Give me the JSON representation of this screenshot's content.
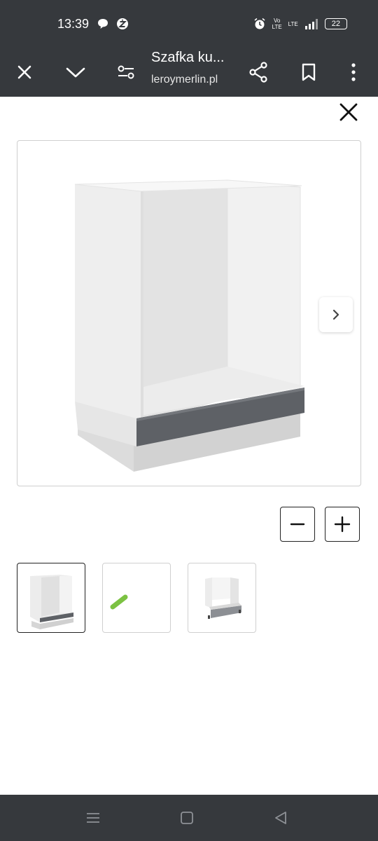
{
  "status_bar": {
    "time": "13:39",
    "left_icons": [
      "chat-bubble-icon",
      "z-badge-icon"
    ],
    "volte_label": "Vo LTE",
    "lte_label": "LTE",
    "battery": "22"
  },
  "toolbar": {
    "title": "Szafka ku...",
    "url": "leroymerlin.pl",
    "icons": [
      "close-icon",
      "chevron-down-icon",
      "page-settings-icon",
      "share-icon",
      "bookmark-icon",
      "more-vert-icon"
    ]
  },
  "gallery": {
    "close_icon": "close-icon",
    "next_icon": "chevron-right-icon",
    "zoom_out_icon": "minus-icon",
    "zoom_in_icon": "plus-icon",
    "thumbnails": [
      {
        "name": "cabinet-front",
        "active": true
      },
      {
        "name": "color-swatch",
        "active": false
      },
      {
        "name": "cabinet-with-drawer",
        "active": false
      }
    ],
    "colors": {
      "cabinet_white": "#f1f1f1",
      "drawer_grey": "#5e6166",
      "swatch_green": "#7cc242"
    }
  },
  "nav_bar": {
    "icons": [
      "recents-icon",
      "home-icon",
      "back-icon"
    ]
  }
}
